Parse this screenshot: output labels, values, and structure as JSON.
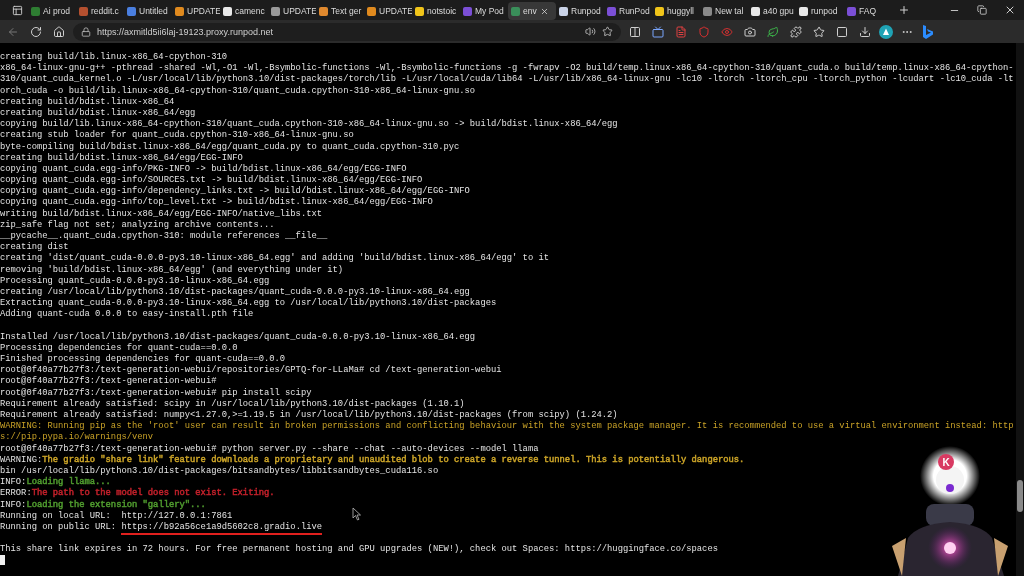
{
  "browser": {
    "tabs": [
      {
        "title": "Ai prod",
        "color": "#2e7d32",
        "selected": false
      },
      {
        "title": "reddit.c",
        "color": "#b5502f",
        "selected": false
      },
      {
        "title": "Untitled",
        "color": "#4a7fe0",
        "selected": false
      },
      {
        "title": "UPDATE",
        "color": "#e08a1e",
        "selected": false
      },
      {
        "title": "camenc",
        "color": "#e8e8e8",
        "selected": false
      },
      {
        "title": "UPDATE",
        "color": "#9a9a9a",
        "selected": false
      },
      {
        "title": "Text ger",
        "color": "#e0892e",
        "selected": false
      },
      {
        "title": "UPDATE",
        "color": "#e08a1e",
        "selected": false
      },
      {
        "title": "notstoic",
        "color": "#f0c419",
        "selected": false
      },
      {
        "title": "My Pod",
        "color": "#7b4fd6",
        "selected": false
      },
      {
        "title": "env",
        "color": "#3a8f5a",
        "selected": true
      },
      {
        "title": "Runpod",
        "color": "#c9d2e6",
        "selected": false
      },
      {
        "title": "RunPod",
        "color": "#7b4fd6",
        "selected": false
      },
      {
        "title": "huggyll",
        "color": "#f0c419",
        "selected": false
      },
      {
        "title": "New tal",
        "color": "#8a8a8a",
        "selected": false
      },
      {
        "title": "a40 gpu",
        "color": "#e8e8e8",
        "selected": false
      },
      {
        "title": "runpod",
        "color": "#e8e8e8",
        "selected": false
      },
      {
        "title": "FAQ",
        "color": "#7b4fd6",
        "selected": false
      }
    ],
    "address": {
      "url": "https://axmitld5ii6laj-19123.proxy.runpod.net"
    }
  },
  "terminal": {
    "lines": [
      {
        "kind": "plain",
        "text": "creating build/lib.linux-x86_64-cpython-310"
      },
      {
        "kind": "plain",
        "text": "x86_64-linux-gnu-g++ -pthread -shared -Wl,-O1 -Wl,-Bsymbolic-functions -Wl,-Bsymbolic-functions -g -fwrapv -O2 build/temp.linux-x86_64-cpython-310/quant_cuda.o build/temp.linux-x86_64-cpython-"
      },
      {
        "kind": "plain",
        "text": "310/quant_cuda_kernel.o -L/usr/local/lib/python3.10/dist-packages/torch/lib -L/usr/local/cuda/lib64 -L/usr/lib/x86_64-linux-gnu -lc10 -ltorch -ltorch_cpu -ltorch_python -lcudart -lc10_cuda -lt"
      },
      {
        "kind": "plain",
        "text": "orch_cuda -o build/lib.linux-x86_64-cpython-310/quant_cuda.cpython-310-x86_64-linux-gnu.so"
      },
      {
        "kind": "plain",
        "text": "creating build/bdist.linux-x86_64"
      },
      {
        "kind": "plain",
        "text": "creating build/bdist.linux-x86_64/egg"
      },
      {
        "kind": "plain",
        "text": "copying build/lib.linux-x86_64-cpython-310/quant_cuda.cpython-310-x86_64-linux-gnu.so -> build/bdist.linux-x86_64/egg"
      },
      {
        "kind": "plain",
        "text": "creating stub loader for quant_cuda.cpython-310-x86_64-linux-gnu.so"
      },
      {
        "kind": "plain",
        "text": "byte-compiling build/bdist.linux-x86_64/egg/quant_cuda.py to quant_cuda.cpython-310.pyc"
      },
      {
        "kind": "plain",
        "text": "creating build/bdist.linux-x86_64/egg/EGG-INFO"
      },
      {
        "kind": "plain",
        "text": "copying quant_cuda.egg-info/PKG-INFO -> build/bdist.linux-x86_64/egg/EGG-INFO"
      },
      {
        "kind": "plain",
        "text": "copying quant_cuda.egg-info/SOURCES.txt -> build/bdist.linux-x86_64/egg/EGG-INFO"
      },
      {
        "kind": "plain",
        "text": "copying quant_cuda.egg-info/dependency_links.txt -> build/bdist.linux-x86_64/egg/EGG-INFO"
      },
      {
        "kind": "plain",
        "text": "copying quant_cuda.egg-info/top_level.txt -> build/bdist.linux-x86_64/egg/EGG-INFO"
      },
      {
        "kind": "plain",
        "text": "writing build/bdist.linux-x86_64/egg/EGG-INFO/native_libs.txt"
      },
      {
        "kind": "plain",
        "text": "zip_safe flag not set; analyzing archive contents..."
      },
      {
        "kind": "plain",
        "text": "__pycache__.quant_cuda.cpython-310: module references __file__"
      },
      {
        "kind": "plain",
        "text": "creating dist"
      },
      {
        "kind": "plain",
        "text": "creating 'dist/quant_cuda-0.0.0-py3.10-linux-x86_64.egg' and adding 'build/bdist.linux-x86_64/egg' to it"
      },
      {
        "kind": "plain",
        "text": "removing 'build/bdist.linux-x86_64/egg' (and everything under it)"
      },
      {
        "kind": "plain",
        "text": "Processing quant_cuda-0.0.0-py3.10-linux-x86_64.egg"
      },
      {
        "kind": "plain",
        "text": "creating /usr/local/lib/python3.10/dist-packages/quant_cuda-0.0.0-py3.10-linux-x86_64.egg"
      },
      {
        "kind": "plain",
        "text": "Extracting quant_cuda-0.0.0-py3.10-linux-x86_64.egg to /usr/local/lib/python3.10/dist-packages"
      },
      {
        "kind": "plain",
        "text": "Adding quant-cuda 0.0.0 to easy-install.pth file"
      },
      {
        "kind": "blank"
      },
      {
        "kind": "plain",
        "text": "Installed /usr/local/lib/python3.10/dist-packages/quant_cuda-0.0.0-py3.10-linux-x86_64.egg"
      },
      {
        "kind": "plain",
        "text": "Processing dependencies for quant-cuda==0.0.0"
      },
      {
        "kind": "plain",
        "text": "Finished processing dependencies for quant-cuda==0.0.0"
      },
      {
        "kind": "plain",
        "text": "root@0f40a77b27f3:/text-generation-webui/repositories/GPTQ-for-LLaMa# cd /text-generation-webui"
      },
      {
        "kind": "plain",
        "text": "root@0f40a77b27f3:/text-generation-webui#"
      },
      {
        "kind": "plain",
        "text": "root@0f40a77b27f3:/text-generation-webui# pip install scipy"
      },
      {
        "kind": "plain",
        "text": "Requirement already satisfied: scipy in /usr/local/lib/python3.10/dist-packages (1.10.1)"
      },
      {
        "kind": "plain",
        "text": "Requirement already satisfied: numpy<1.27.0,>=1.19.5 in /usr/local/lib/python3.10/dist-packages (from scipy) (1.24.2)"
      },
      {
        "kind": "warning",
        "text": "WARNING: Running pip as the 'root' user can result in broken permissions and conflicting behaviour with the system package manager. It is recommended to use a virtual environment instead: http"
      },
      {
        "kind": "warning",
        "text": "s://pip.pypa.io/warnings/venv"
      },
      {
        "kind": "plain",
        "text": "root@0f40a77b27f3:/text-generation-webui# python server.py --share --chat --auto-devices --model llama"
      },
      {
        "kind": "tagged",
        "tag": "WARNING:",
        "text": "The gradio \"share link\" feature downloads a proprietary and unaudited blob to create a reverse tunnel. This is potentially dangerous.",
        "color": "#c9a227"
      },
      {
        "kind": "plain",
        "text": "bin /usr/local/lib/python3.10/dist-packages/bitsandbytes/libbitsandbytes_cuda116.so"
      },
      {
        "kind": "tagged",
        "tag": "INFO:",
        "text": "Loading llama...",
        "color": "#4f9a2e"
      },
      {
        "kind": "tagged",
        "tag": "ERROR:",
        "text": "The path to the model does not exist. Exiting.",
        "color": "#c0202a"
      },
      {
        "kind": "tagged",
        "tag": "INFO:",
        "text": "Loading the extension \"gallery\"...",
        "color": "#4f9a2e"
      },
      {
        "kind": "link",
        "label": "Running on local URL:  ",
        "url": "http://127.0.0.1:7861",
        "underlined": false
      },
      {
        "kind": "link",
        "label": "Running on public URL: ",
        "url": "https://b92a56ce1a9d5602c8.gradio.live",
        "underlined": true
      },
      {
        "kind": "blank"
      },
      {
        "kind": "plain",
        "text": "This share link expires in 72 hours. For free permanent hosting and GPU upgrades (NEW!), check out Spaces: https://huggingface.co/spaces"
      },
      {
        "kind": "cursor"
      }
    ]
  },
  "overlay": {
    "badge": "K"
  }
}
